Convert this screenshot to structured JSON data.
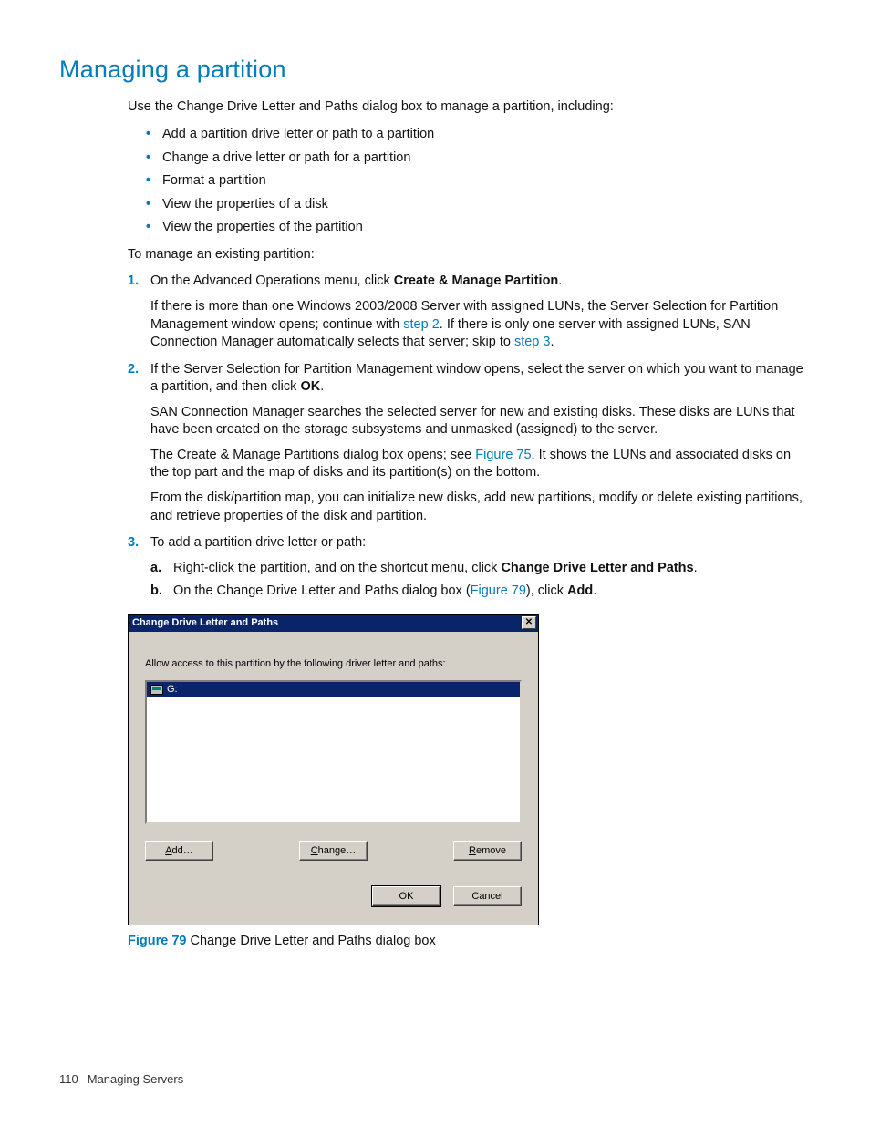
{
  "title": "Managing a partition",
  "lead": "Use the Change Drive Letter and Paths dialog box to manage a partition, including:",
  "bullets": [
    "Add a partition drive letter or path to a partition",
    "Change a drive letter or path for a partition",
    "Format a partition",
    "View the properties of a disk",
    "View the properties of the partition"
  ],
  "intro2": "To manage an existing partition:",
  "step1": {
    "pre": "On the Advanced Operations menu, click ",
    "bold": "Create & Manage Partition",
    "post": ".",
    "p2a": "If there is more than one Windows 2003/2008 Server with assigned LUNs, the Server Selection for Partition Management window opens; continue with ",
    "p2link1": "step 2",
    "p2b": ". If there is only one server with assigned LUNs, SAN Connection Manager automatically selects that server; skip to ",
    "p2link2": "step 3",
    "p2c": "."
  },
  "step2": {
    "pre": "If the Server Selection for Partition Management window opens, select the server on which you want to manage a partition, and then click ",
    "bold": "OK",
    "post": ".",
    "p2": "SAN Connection Manager searches the selected server for new and existing disks. These disks are LUNs that have been created on the storage subsystems and unmasked (assigned) to the server.",
    "p3a": "The Create & Manage Partitions dialog box opens; see ",
    "p3link": "Figure 75",
    "p3b": ". It shows the LUNs and associated disks on the top part and the map of disks and its partition(s) on the bottom.",
    "p4": "From the disk/partition map, you can initialize new disks, add new partitions, modify or delete existing partitions, and retrieve properties of the disk and partition."
  },
  "step3": {
    "text": "To add a partition drive letter or path:",
    "a": {
      "pre": "Right-click the partition, and on the shortcut menu, click ",
      "bold": "Change Drive Letter and Paths",
      "post": "."
    },
    "b": {
      "pre": "On the Change Drive Letter and Paths dialog box (",
      "link": "Figure 79",
      "mid": "), click ",
      "bold": "Add",
      "post": "."
    }
  },
  "dialog": {
    "title": "Change Drive Letter and Paths",
    "hint": "Allow access to this partition by the following driver letter and paths:",
    "item": "G:",
    "add_u": "A",
    "add_rest": "dd…",
    "change_u": "C",
    "change_rest": "hange…",
    "remove_u": "R",
    "remove_rest": "emove",
    "ok": "OK",
    "cancel": "Cancel"
  },
  "figure": {
    "num": "Figure 79",
    "caption": " Change Drive Letter and Paths dialog box"
  },
  "footer": {
    "page": "110",
    "section": "Managing Servers"
  }
}
